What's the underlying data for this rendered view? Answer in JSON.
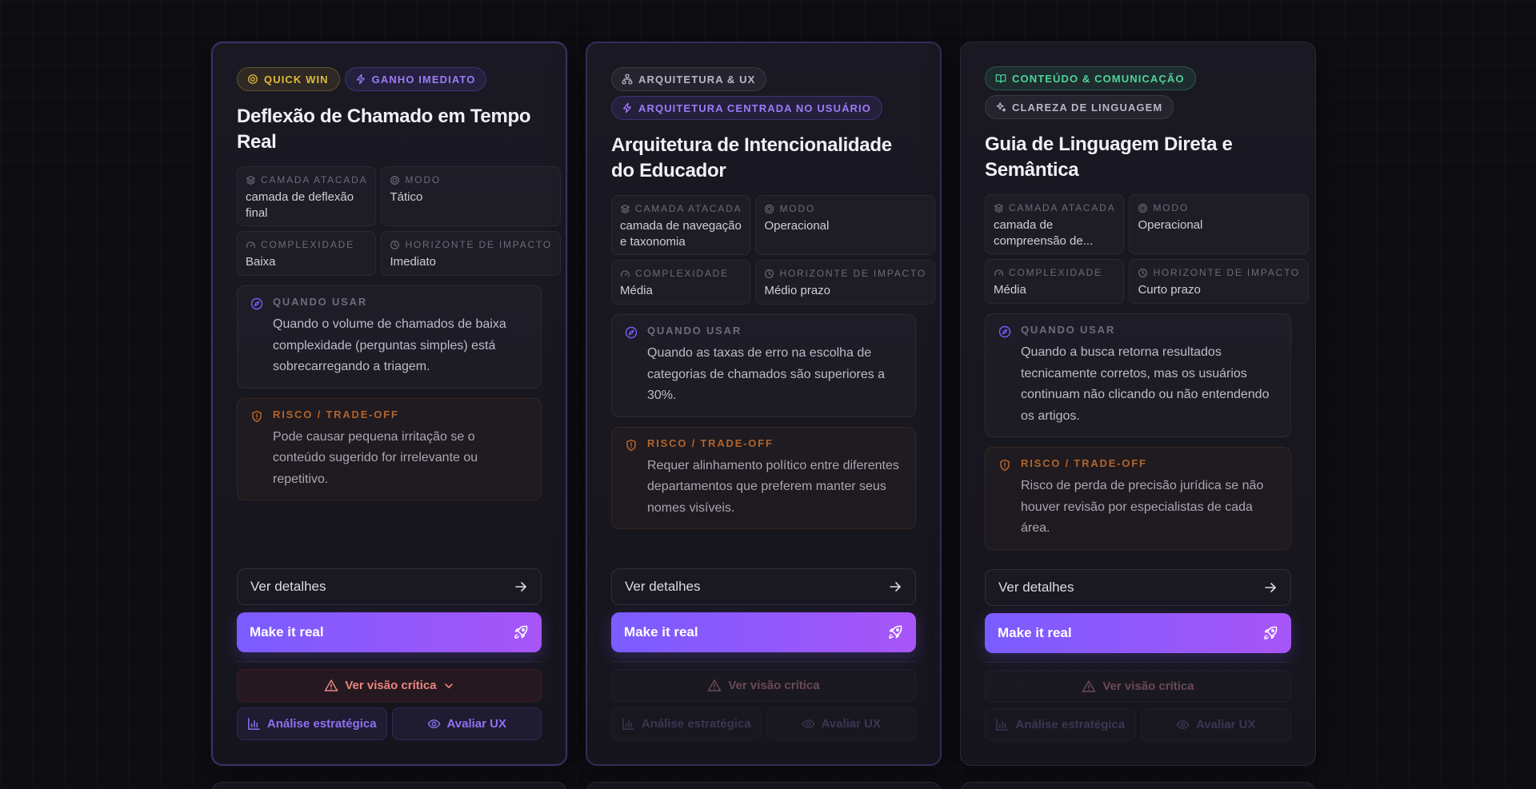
{
  "colors": {
    "accent": "#7a5cff",
    "accent_end": "#a855f7",
    "quick_win": "#e2b93b",
    "content_green": "#4fd39a",
    "risk": "#b3642b",
    "critical": "#e8857f"
  },
  "cards": [
    {
      "badges": [
        {
          "label": "QUICK WIN",
          "icon": "target-icon"
        },
        {
          "label": "GANHO IMEDIATO",
          "icon": "lightning-icon"
        }
      ],
      "title": "Deflexão de Chamado em Tempo Real",
      "meta": [
        {
          "label": "CAMADA ATACADA",
          "value": "camada de deflexão final",
          "icon": "layers-icon"
        },
        {
          "label": "MODO",
          "value": "Tático",
          "icon": "mode-icon"
        },
        {
          "label": "COMPLEXIDADE",
          "value": "Baixa",
          "icon": "gauge-icon"
        },
        {
          "label": "HORIZONTE DE IMPACTO",
          "value": "Imediato",
          "icon": "clock-icon"
        }
      ],
      "when_label": "QUANDO USAR",
      "when_text": "Quando o volume de chamados de baixa complexidade (perguntas simples) está sobrecarregando a triagem.",
      "risk_label": "RISCO / TRADE-OFF",
      "risk_text": "Pode causar pequena irritação se o conteúdo sugerido for irrelevante ou repetitivo.",
      "details_label": "Ver detalhes",
      "make_real_label": "Make it real",
      "critical_label": "Ver visão crítica",
      "strategic_label": "Análise estratégica",
      "ux_label": "Avaliar UX"
    },
    {
      "badges": [
        {
          "label": "ARQUITETURA & UX",
          "icon": "sitemap-icon"
        },
        {
          "label": "ARQUITETURA CENTRADA NO USUÁRIO",
          "icon": "lightning-icon"
        }
      ],
      "title": "Arquitetura de Intencionalidade do Educador",
      "meta": [
        {
          "label": "CAMADA ATACADA",
          "value": "camada de navegação e taxonomia",
          "icon": "layers-icon"
        },
        {
          "label": "MODO",
          "value": "Operacional",
          "icon": "mode-icon"
        },
        {
          "label": "COMPLEXIDADE",
          "value": "Média",
          "icon": "gauge-icon"
        },
        {
          "label": "HORIZONTE DE IMPACTO",
          "value": "Médio prazo",
          "icon": "clock-icon"
        }
      ],
      "when_label": "QUANDO USAR",
      "when_text": "Quando as taxas de erro na escolha de categorias de chamados são superiores a 30%.",
      "risk_label": "RISCO / TRADE-OFF",
      "risk_text": "Requer alinhamento político entre diferentes departamentos que preferem manter seus nomes visíveis.",
      "details_label": "Ver detalhes",
      "make_real_label": "Make it real",
      "critical_label": "Ver visão crítica",
      "strategic_label": "Análise estratégica",
      "ux_label": "Avaliar UX"
    },
    {
      "badges": [
        {
          "label": "CONTEÚDO & COMUNICAÇÃO",
          "icon": "book-icon"
        },
        {
          "label": "CLAREZA DE LINGUAGEM",
          "icon": "sparkles-icon"
        }
      ],
      "title": "Guia de Linguagem Direta e Semântica",
      "meta": [
        {
          "label": "CAMADA ATACADA",
          "value": "camada de compreensão de...",
          "icon": "layers-icon"
        },
        {
          "label": "MODO",
          "value": "Operacional",
          "icon": "mode-icon"
        },
        {
          "label": "COMPLEXIDADE",
          "value": "Média",
          "icon": "gauge-icon"
        },
        {
          "label": "HORIZONTE DE IMPACTO",
          "value": "Curto prazo",
          "icon": "clock-icon"
        }
      ],
      "when_label": "QUANDO USAR",
      "when_text": "Quando a busca retorna resultados tecnicamente corretos, mas os usuários continuam não clicando ou não entendendo os artigos.",
      "risk_label": "RISCO / TRADE-OFF",
      "risk_text": "Risco de perda de precisão jurídica se não houver revisão por especialistas de cada área.",
      "details_label": "Ver detalhes",
      "make_real_label": "Make it real",
      "critical_label": "Ver visão crítica",
      "strategic_label": "Análise estratégica",
      "ux_label": "Avaliar UX"
    }
  ]
}
